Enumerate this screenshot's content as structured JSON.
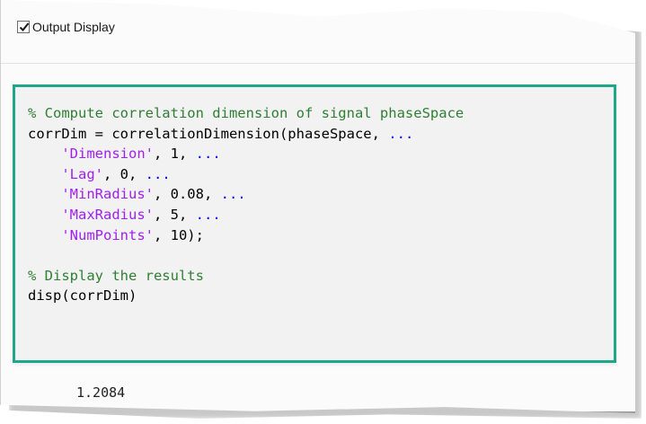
{
  "header": {
    "checkbox_checked": true,
    "label": "Output Display"
  },
  "code_lines": [
    {
      "segments": [
        {
          "type": "comment",
          "text": "% Compute correlation dimension of signal phaseSpace"
        }
      ]
    },
    {
      "segments": [
        {
          "type": "plain",
          "text": "corrDim = correlationDimension(phaseSpace, "
        },
        {
          "type": "cont",
          "text": "..."
        }
      ]
    },
    {
      "segments": [
        {
          "type": "plain",
          "text": "    "
        },
        {
          "type": "str",
          "text": "'Dimension'"
        },
        {
          "type": "plain",
          "text": ", 1, "
        },
        {
          "type": "cont",
          "text": "..."
        }
      ]
    },
    {
      "segments": [
        {
          "type": "plain",
          "text": "    "
        },
        {
          "type": "str",
          "text": "'Lag'"
        },
        {
          "type": "plain",
          "text": ", 0, "
        },
        {
          "type": "cont",
          "text": "..."
        }
      ]
    },
    {
      "segments": [
        {
          "type": "plain",
          "text": "    "
        },
        {
          "type": "str",
          "text": "'MinRadius'"
        },
        {
          "type": "plain",
          "text": ", 0.08, "
        },
        {
          "type": "cont",
          "text": "..."
        }
      ]
    },
    {
      "segments": [
        {
          "type": "plain",
          "text": "    "
        },
        {
          "type": "str",
          "text": "'MaxRadius'"
        },
        {
          "type": "plain",
          "text": ", 5, "
        },
        {
          "type": "cont",
          "text": "..."
        }
      ]
    },
    {
      "segments": [
        {
          "type": "plain",
          "text": "    "
        },
        {
          "type": "str",
          "text": "'NumPoints'"
        },
        {
          "type": "plain",
          "text": ", 10);"
        }
      ]
    },
    {
      "segments": [
        {
          "type": "plain",
          "text": ""
        }
      ]
    },
    {
      "segments": [
        {
          "type": "comment",
          "text": "% Display the results"
        }
      ]
    },
    {
      "segments": [
        {
          "type": "plain",
          "text": "disp(corrDim)"
        }
      ]
    }
  ],
  "output": {
    "value": "1.2084"
  },
  "colors": {
    "highlight_border": "#1fa58a",
    "comment": "#2f7f33",
    "string": "#a020f0",
    "continuation": "#0000ff",
    "code_background": "#f2f2f2"
  }
}
